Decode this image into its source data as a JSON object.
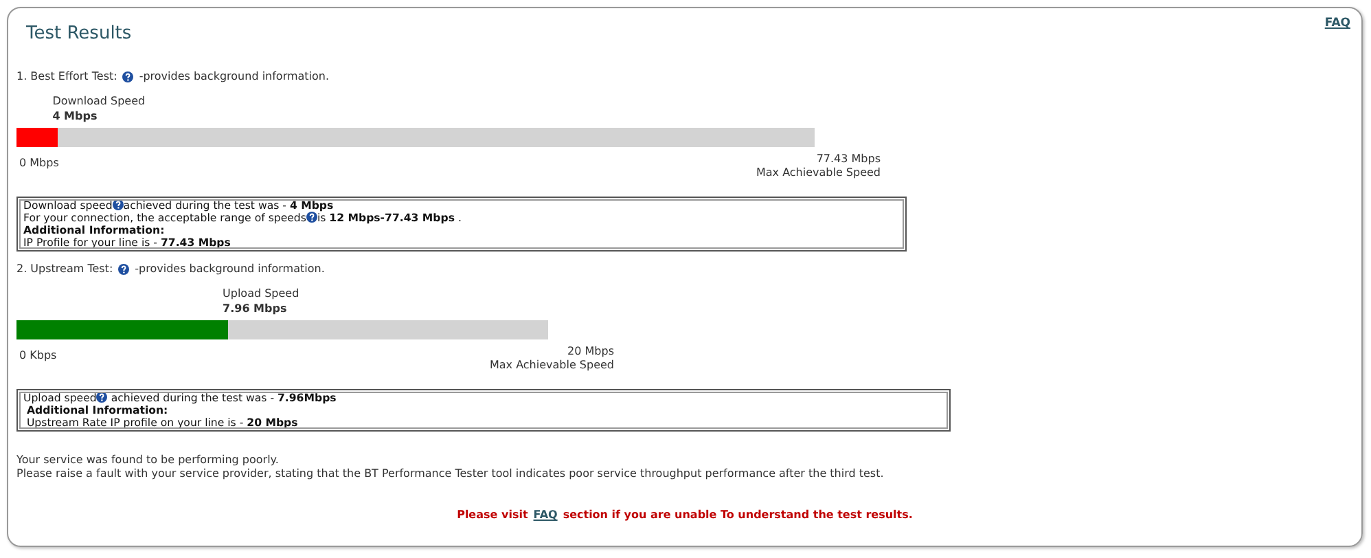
{
  "title": "Test Results",
  "faq_link": "FAQ",
  "tests": [
    {
      "heading": "1. Best Effort Test:",
      "help_icon": true,
      "note": "-provides background information.",
      "gauge": {
        "label": "Download Speed",
        "value": "4 Mbps",
        "level": 0.052,
        "color": "#ff0000",
        "min_label": "0 Mbps",
        "max_value": "77.43 Mbps",
        "max_label": "Max Achievable Speed"
      },
      "info": [
        {
          "before": "Download speed",
          "help_icon": true,
          "after": "achieved during the test was - **4 Mbps**"
        },
        {
          "before": "For your connection, the acceptable range of speeds",
          "help_icon": true,
          "after": "is **12 Mbps-77.43 Mbps** ."
        },
        {
          "before": "**Additional Information:**",
          "help_icon": false
        },
        {
          "before": "IP Profile for your line is - **77.43 Mbps**",
          "help_icon": false
        }
      ]
    },
    {
      "heading": "2. Upstream Test:",
      "help_icon": true,
      "note": "-provides background information.",
      "gauge": {
        "label": "Upload Speed",
        "value": "7.96 Mbps",
        "level": 0.398,
        "color": "#008000",
        "min_label": "0 Kbps",
        "max_value": "20 Mbps",
        "max_label": "Max Achievable Speed"
      },
      "info": [
        {
          "before": "Upload speed",
          "help_icon": true,
          "after": " achieved during the test was - **7.96Mbps**"
        },
        {
          "before": " **Additional Information:**",
          "help_icon": false
        },
        {
          "before": " Upstream Rate IP profile on your line is - **20 Mbps**",
          "help_icon": false
        }
      ]
    }
  ],
  "summary": [
    "Your service was found to be performing poorly.",
    "Please raise a fault with your service provider, stating that the BT Performance Tester tool indicates poor service throughput performance after the third test."
  ],
  "footer": {
    "before": "Please visit",
    "link": "FAQ",
    "after": "section if you are unable To understand the test results."
  }
}
